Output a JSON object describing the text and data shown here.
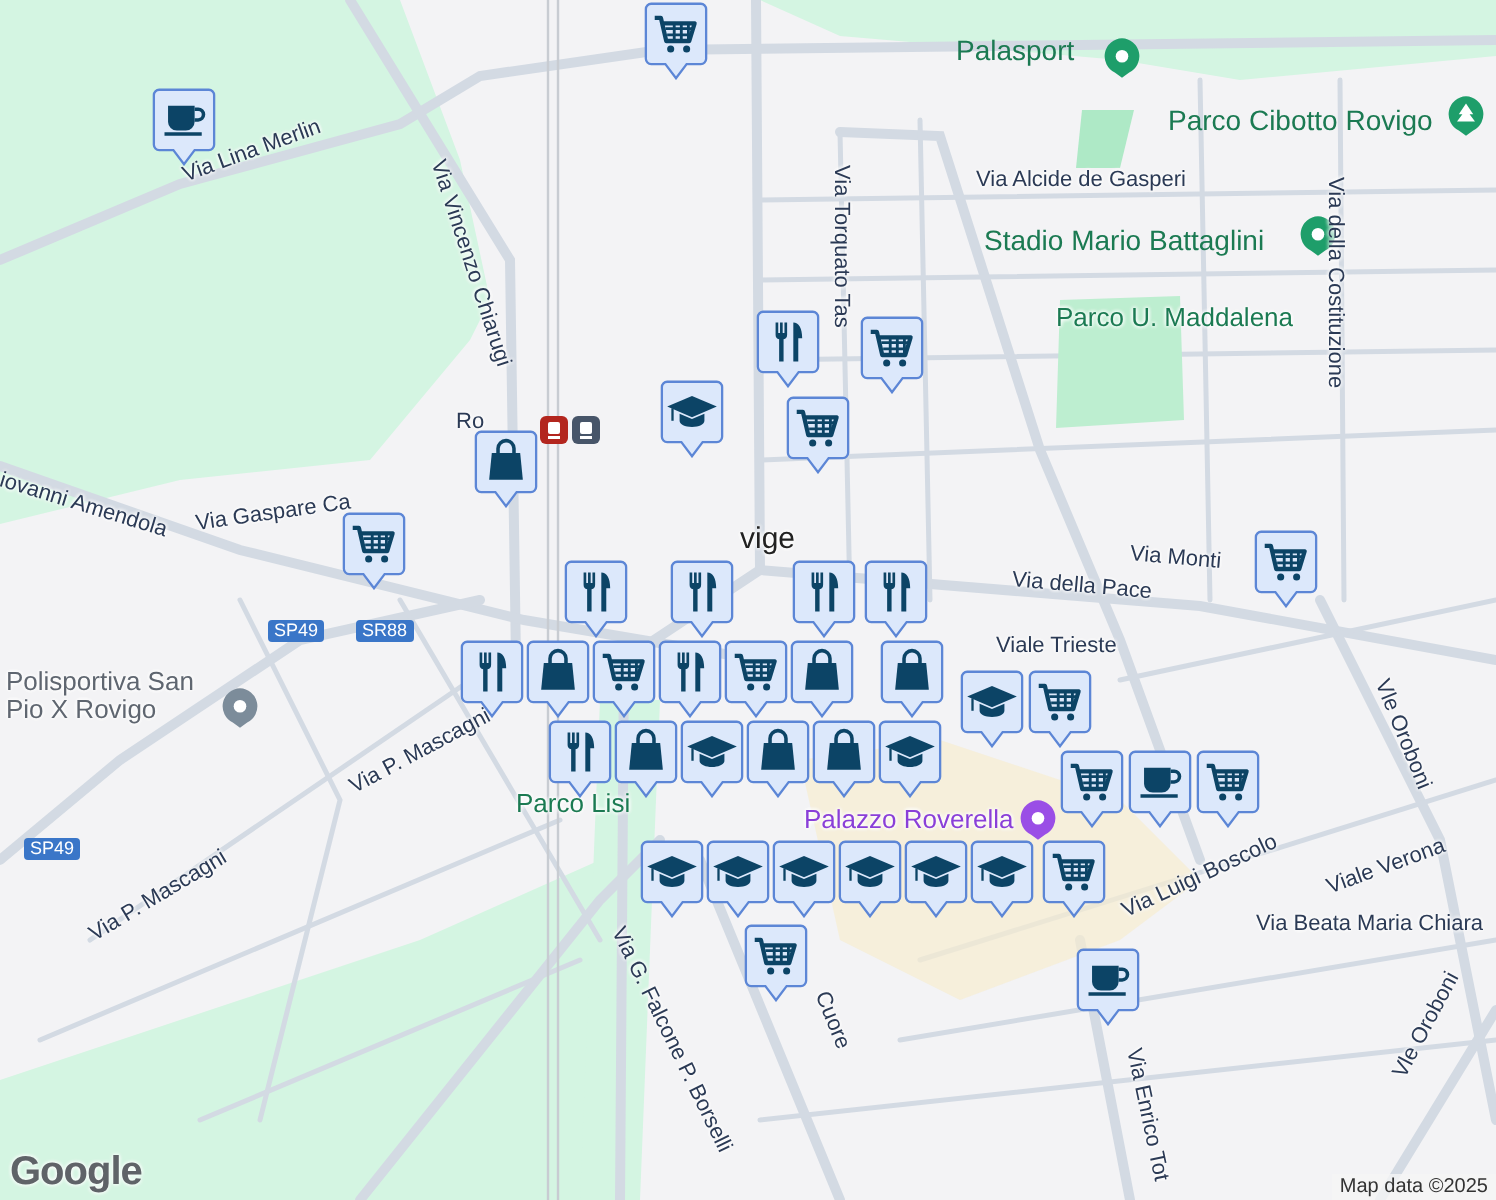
{
  "map": {
    "labels": [
      {
        "text": "Palasport",
        "kind": "poi"
      },
      {
        "text": "Parco Cibotto Rovigo",
        "kind": "poi"
      },
      {
        "text": "Via Alcide de Gasperi",
        "kind": "street"
      },
      {
        "text": "Stadio Mario Battaglini",
        "kind": "poi"
      },
      {
        "text": "Via Torquato Tas",
        "kind": "street"
      },
      {
        "text": "Via della Costituzione",
        "kind": "street"
      },
      {
        "text": "Parco U. Maddalena",
        "kind": "park"
      },
      {
        "text": "Via Lina Merlin",
        "kind": "street"
      },
      {
        "text": "Via Vincenzo Chiarugi",
        "kind": "street"
      },
      {
        "text": "Ro",
        "kind": "street"
      },
      {
        "text": "iovanni Amendola",
        "kind": "street"
      },
      {
        "text": "Via Gaspare Ca",
        "kind": "street"
      },
      {
        "text": "vige",
        "kind": "town"
      },
      {
        "text": "Via Monti",
        "kind": "street"
      },
      {
        "text": "Via della Pace",
        "kind": "street"
      },
      {
        "text": "Viale Trieste",
        "kind": "street"
      },
      {
        "text": "SP49",
        "kind": "badge"
      },
      {
        "text": "SR88",
        "kind": "badge"
      },
      {
        "text": "Polisportiva San Pio X Rovigo",
        "kind": "place"
      },
      {
        "text": "SP49",
        "kind": "badge"
      },
      {
        "text": "Via P. Mascagni",
        "kind": "street"
      },
      {
        "text": "Via P. Mascagni",
        "kind": "street"
      },
      {
        "text": "Parco Lisi",
        "kind": "park"
      },
      {
        "text": "Palazzo Roverella",
        "kind": "museum"
      },
      {
        "text": "Via Luigi Boscolo",
        "kind": "street"
      },
      {
        "text": "Viale Verona",
        "kind": "street"
      },
      {
        "text": "Via Beata Maria Chiara",
        "kind": "street"
      },
      {
        "text": "Vle Oroboni",
        "kind": "street"
      },
      {
        "text": "Vle Oroboni",
        "kind": "street"
      },
      {
        "text": "Via G. Falcone P. Borselli",
        "kind": "street"
      },
      {
        "text": "Cuore",
        "kind": "street"
      },
      {
        "text": "Via Enrico Tot",
        "kind": "street"
      }
    ],
    "markers": [
      {
        "kind": "cart"
      },
      {
        "kind": "cup"
      },
      {
        "kind": "fork"
      },
      {
        "kind": "cart"
      },
      {
        "kind": "cart"
      },
      {
        "kind": "cap"
      },
      {
        "kind": "bag"
      },
      {
        "kind": "cart"
      },
      {
        "kind": "cart"
      },
      {
        "kind": "fork"
      },
      {
        "kind": "fork"
      },
      {
        "kind": "fork"
      },
      {
        "kind": "bag"
      },
      {
        "kind": "cart"
      },
      {
        "kind": "fork"
      },
      {
        "kind": "cart"
      },
      {
        "kind": "fork"
      },
      {
        "kind": "fork"
      },
      {
        "kind": "bag"
      },
      {
        "kind": "bag"
      },
      {
        "kind": "cap"
      },
      {
        "kind": "bag"
      },
      {
        "kind": "bag"
      },
      {
        "kind": "cap"
      },
      {
        "kind": "cap"
      },
      {
        "kind": "bag"
      },
      {
        "kind": "cart"
      },
      {
        "kind": "cart"
      },
      {
        "kind": "cup"
      },
      {
        "kind": "cart"
      },
      {
        "kind": "fork"
      },
      {
        "kind": "cap"
      },
      {
        "kind": "cap"
      },
      {
        "kind": "cap"
      },
      {
        "kind": "cap"
      },
      {
        "kind": "cap"
      },
      {
        "kind": "cap"
      },
      {
        "kind": "cart"
      },
      {
        "kind": "cart"
      },
      {
        "kind": "cup"
      }
    ],
    "logo": "Google",
    "attribution": "Map data ©2025"
  }
}
